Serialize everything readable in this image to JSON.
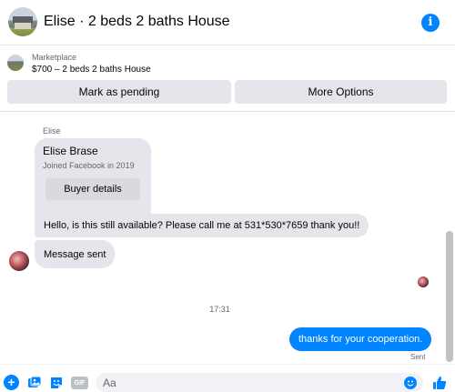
{
  "header": {
    "title": "Elise · 2 beds 2 baths House",
    "info_icon": "info-icon"
  },
  "marketplace": {
    "label": "Marketplace",
    "listing": "$700 – 2 beds 2 baths House",
    "buttons": {
      "pending": "Mark as pending",
      "more": "More Options"
    }
  },
  "chat": {
    "sender_label": "Elise",
    "profile": {
      "name": "Elise Brase",
      "joined": "Joined Facebook in 2019",
      "buyer_details": "Buyer details"
    },
    "messages": [
      "Hello, is this still available? Please call me at 531*530*7659 thank you!!",
      "Message sent"
    ],
    "timestamp": "17:31",
    "my_message": "thanks for your cooperation.",
    "status": "Sent"
  },
  "composer": {
    "placeholder": "Aa",
    "gif_label": "GIF",
    "accent_color": "#0084ff"
  }
}
